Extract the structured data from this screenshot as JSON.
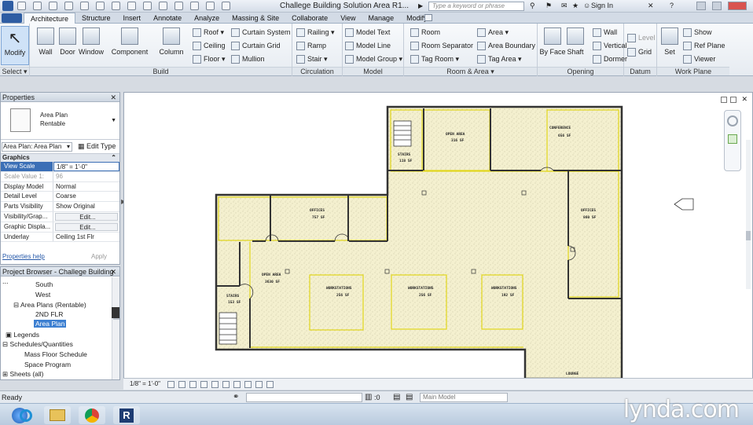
{
  "app": {
    "title": "Challege Building Solution  Area R1...",
    "search_placeholder": "Type a keyword or phrase",
    "sign_in": "Sign In"
  },
  "ribbon": {
    "tabs": [
      "Architecture",
      "Structure",
      "Insert",
      "Annotate",
      "Analyze",
      "Massing & Site",
      "Collaborate",
      "View",
      "Manage",
      "Modify"
    ],
    "active_tab": "Architecture",
    "select_label": "Select",
    "build": {
      "label": "Build",
      "big_buttons": [
        "Modify",
        "Wall",
        "Door",
        "Window",
        "Component",
        "Column"
      ],
      "small_buttons": [
        "Roof",
        "Ceiling",
        "Floor",
        "Curtain System",
        "Curtain Grid",
        "Mullion"
      ]
    },
    "circulation": {
      "label": "Circulation",
      "buttons": [
        "Railing",
        "Ramp",
        "Stair"
      ]
    },
    "model": {
      "label": "Model",
      "buttons": [
        "Model Text",
        "Model Line",
        "Model Group"
      ]
    },
    "room_area": {
      "label": "Room & Area",
      "buttons": [
        "Room",
        "Room Separator",
        "Tag Room",
        "Area",
        "Area Boundary",
        "Tag Area"
      ]
    },
    "opening": {
      "label": "Opening",
      "buttons": [
        "By Face",
        "Shaft",
        "Wall",
        "Vertical",
        "Dormer"
      ]
    },
    "datum": {
      "label": "Datum",
      "buttons": [
        "Level",
        "Grid"
      ]
    },
    "work_plane": {
      "label": "Work Plane",
      "buttons": [
        "Set",
        "Show",
        "Ref  Plane",
        "Viewer"
      ]
    }
  },
  "properties": {
    "title": "Properties",
    "type_line1": "Area Plan",
    "type_line2": "Rentable",
    "type_selector": "Area Plan: Area Plan",
    "edit_type": "Edit Type",
    "section": "Graphics",
    "rows": [
      {
        "k": "View Scale",
        "v": "1/8\" = 1'-0\""
      },
      {
        "k": "Scale Value    1:",
        "v": "96"
      },
      {
        "k": "Display Model",
        "v": "Normal"
      },
      {
        "k": "Detail Level",
        "v": "Coarse"
      },
      {
        "k": "Parts Visibility",
        "v": "Show Original"
      },
      {
        "k": "Visibility/Grap...",
        "v": "Edit..."
      },
      {
        "k": "Graphic Displa...",
        "v": "Edit..."
      },
      {
        "k": "Underlay",
        "v": "Ceiling 1st Flr"
      }
    ],
    "help": "Properties help",
    "apply": "Apply"
  },
  "browser": {
    "title": "Project Browser - Challege Building ...",
    "items": [
      "South",
      "West",
      "Area Plans (Rentable)",
      "2ND FLR",
      "Area Plan",
      "Legends",
      "Schedules/Quantities",
      "Mass Floor Schedule",
      "Space Program",
      "Sheets (all)"
    ]
  },
  "plan": {
    "rooms": [
      {
        "name": "OPEN AREA",
        "area": "316 SF"
      },
      {
        "name": "CONFERENCE",
        "area": "656 SF"
      },
      {
        "name": "STAIRS",
        "area": "118 SF"
      },
      {
        "name": "OFFICES",
        "area": "757 SF"
      },
      {
        "name": "OFFICES",
        "area": "860 SF"
      },
      {
        "name": "OPEN AREA",
        "area": "3630 SF"
      },
      {
        "name": "STAIRS",
        "area": "153 SF"
      },
      {
        "name": "WORKSTATIONS",
        "area": "256 SF"
      },
      {
        "name": "WORKSTATIONS",
        "area": "256 SF"
      },
      {
        "name": "WORKSTATIONS",
        "area": "192 SF"
      },
      {
        "name": "LOUNGE",
        "area": ""
      }
    ]
  },
  "view_control": {
    "scale": "1/8\" = 1'-0\""
  },
  "status": {
    "ready": "Ready",
    "zero": ":0",
    "model": "Main Model"
  },
  "watermark": "lynda.com"
}
